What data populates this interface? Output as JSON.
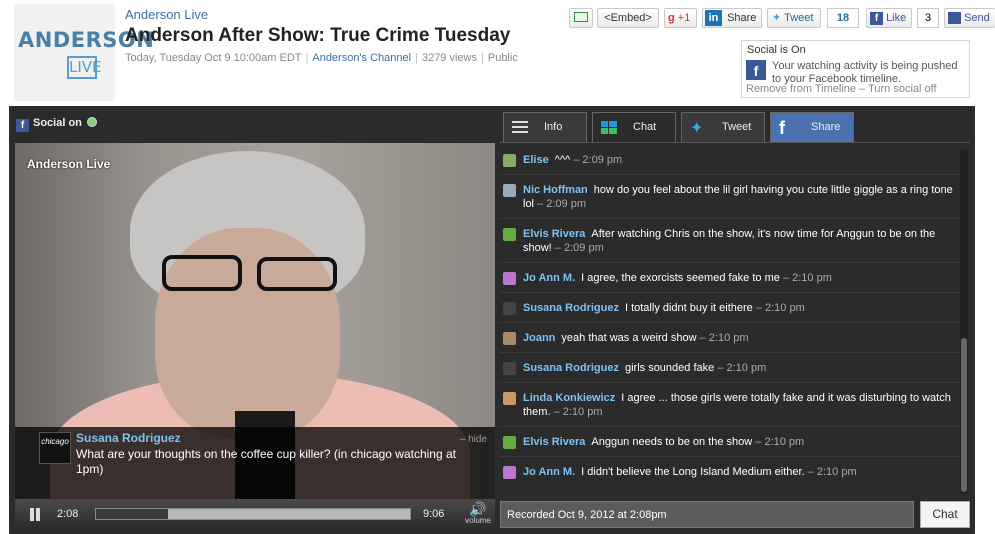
{
  "logo": {
    "top": "ANDERSON",
    "bottom": "LIVE"
  },
  "header": {
    "channel": "Anderson Live",
    "title": "Anderson After Show: True Crime Tuesday",
    "date": "Today, Tuesday Oct 9 10:00am EDT",
    "channel_link": "Anderson's Channel",
    "views": "3279 views",
    "visibility": "Public"
  },
  "share_bar": {
    "embed": "<Embed>",
    "gplus": "+1",
    "share": "Share",
    "tweet": "Tweet",
    "tweet_count": "18",
    "like": "Like",
    "like_count": "3",
    "send": "Send"
  },
  "social_box": {
    "title": "Social is On",
    "desc": "Your watching activity is being pushed to your Facebook timeline.",
    "remove": "Remove from Timeline",
    "turn_off": "Turn social off"
  },
  "player": {
    "social_on": "Social on",
    "brand": "Anderson Live",
    "overlay": {
      "avatar_text": "chicago",
      "name": "Susana Rodriguez",
      "message": "What are your thoughts on the coffee cup killer? (in chicago watching at 1pm)",
      "hide": "– hide"
    },
    "time_current": "2:08",
    "time_duration": "9:06",
    "progress": 0.23,
    "volume_label": "volume"
  },
  "tabs": [
    {
      "label": "Info",
      "icon": "list-icon"
    },
    {
      "label": "Chat",
      "icon": "windows-icon"
    },
    {
      "label": "Tweet",
      "icon": "twitter-icon"
    },
    {
      "label": "Share",
      "icon": "facebook-icon"
    }
  ],
  "chat": [
    {
      "user": "Elise",
      "text": "^^^",
      "time": "– 2:09 pm",
      "color": "#8a6"
    },
    {
      "user": "Nic Hoffman",
      "text": "how do you feel about the lil girl having you cute little giggle as a ring tone lol",
      "time": "– 2:09 pm",
      "color": "#9ab"
    },
    {
      "user": "Elvis Rivera",
      "text": "After watching Chris on the show, it's now time for Anggun to be on the show!",
      "time": "– 2:09 pm",
      "color": "#6a4"
    },
    {
      "user": "Jo Ann M.",
      "text": "I agree, the exorcists seemed fake to me",
      "time": "– 2:10 pm",
      "color": "#b7c"
    },
    {
      "user": "Susana Rodriguez",
      "text": "I totally didnt buy it eithere",
      "time": "– 2:10 pm",
      "color": "#444"
    },
    {
      "user": "Joann",
      "text": "yeah that was a weird show",
      "time": "– 2:10 pm",
      "color": "#a86"
    },
    {
      "user": "Susana Rodriguez",
      "text": "girls sounded fake",
      "time": "– 2:10 pm",
      "color": "#444"
    },
    {
      "user": "Linda Konkiewicz",
      "text": "I agree ... those girls were totally fake and it was disturbing to watch them.",
      "time": "– 2:10 pm",
      "color": "#c96"
    },
    {
      "user": "Elvis Rivera",
      "text": "Anggun needs to be on the show",
      "time": "– 2:10 pm",
      "color": "#6a4"
    },
    {
      "user": "Jo Ann M.",
      "text": "I didn't believe the Long Island Medium either.",
      "time": "– 2:10 pm",
      "color": "#b7c"
    }
  ],
  "recorded": "Recorded Oct 9, 2012 at 2:08pm",
  "chat_button": "Chat"
}
